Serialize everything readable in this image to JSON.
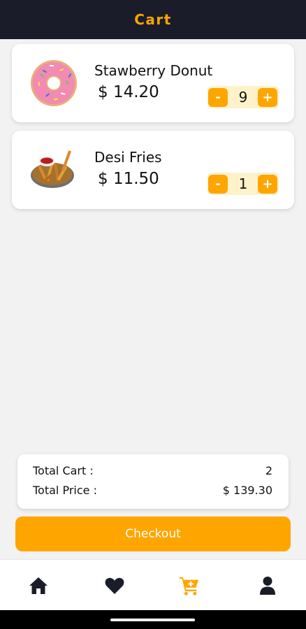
{
  "header": {
    "title": "Cart"
  },
  "cart_items": [
    {
      "name": "Stawberry Donut",
      "price": "$ 14.20",
      "quantity": "9",
      "image": "donut-image"
    },
    {
      "name": "Desi Fries",
      "price": "$ 11.50",
      "quantity": "1",
      "image": "fries-image"
    }
  ],
  "stepper": {
    "minus_label": "-",
    "plus_label": "+"
  },
  "summary": {
    "total_cart_label": "Total Cart :",
    "total_cart_value": "2",
    "total_price_label": "Total Price :",
    "total_price_value": "$ 139.30"
  },
  "checkout": {
    "label": "Checkout"
  },
  "bottom_nav": {
    "items": [
      {
        "icon": "home-icon",
        "active": false
      },
      {
        "icon": "heart-icon",
        "active": false
      },
      {
        "icon": "cart-icon",
        "active": true
      },
      {
        "icon": "user-icon",
        "active": false
      }
    ]
  },
  "colors": {
    "accent": "#ffa500",
    "header_bg": "#1a1d29",
    "nav_icon": "#1a1d29",
    "stepper_bg": "#fdf2c9",
    "page_bg": "#f2f2f2"
  }
}
